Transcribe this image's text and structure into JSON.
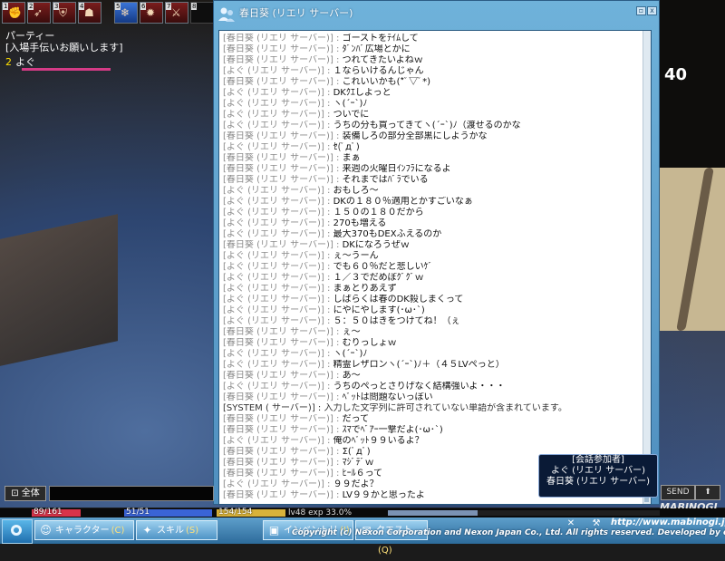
{
  "skillbar": {
    "slots": [
      {
        "key": "1",
        "style": "red",
        "icon": "fist"
      },
      {
        "key": "2",
        "style": "red",
        "icon": "kick"
      },
      {
        "key": "3",
        "style": "red",
        "icon": "shield"
      },
      {
        "key": "4",
        "style": "red",
        "icon": "crouch"
      },
      {
        "key": "5",
        "style": "blue",
        "icon": "ice"
      },
      {
        "key": "6",
        "style": "red",
        "icon": "fire"
      },
      {
        "key": "7",
        "style": "red",
        "icon": "sword"
      },
      {
        "key": "8",
        "style": "empty",
        "icon": ""
      }
    ]
  },
  "party": {
    "title": "パーティー",
    "subtitle": "[入場手伝いお願いします]",
    "member_num": "2",
    "member_name": "よぐ"
  },
  "scene": {
    "big_number": "40"
  },
  "chat": {
    "title": "春日葵 (リエリ サーバー)",
    "minimize": "▫",
    "close": "x",
    "messages": [
      {
        "who": "[春日葵 (リエリ サーバー)]",
        "text": "ゴーストをﾃｲﾑして"
      },
      {
        "who": "[春日葵 (リエリ サーバー)]",
        "text": "ﾀﾞﾝﾊﾞ広場とかに"
      },
      {
        "who": "[春日葵 (リエリ サーバー)]",
        "text": "つれてきたいよねｗ"
      },
      {
        "who": "[よぐ (リエリ サーバー)]",
        "text": "１ならいけるんじゃん"
      },
      {
        "who": "[春日葵 (リエリ サーバー)]",
        "text": "これいいかも(*ﾟ▽ﾟ*)"
      },
      {
        "who": "[よぐ (リエリ サーバー)]",
        "text": "DKｸｴしよっと"
      },
      {
        "who": "[よぐ (リエリ サーバー)]",
        "text": "ヽ(´ｰ`)ﾉ"
      },
      {
        "who": "[よぐ (リエリ サーバー)]",
        "text": "ついでに"
      },
      {
        "who": "[よぐ (リエリ サーバー)]",
        "text": "うちの分も買ってきてヽ(´ｰ`)ﾉ（渡せるのかな"
      },
      {
        "who": "[春日葵 (リエリ サーバー)]",
        "text": "装備しろの部分全部黒にしようかな"
      },
      {
        "who": "[よぐ (リエリ サーバー)]",
        "text": "ｾ(ﾟдﾟ)"
      },
      {
        "who": "[春日葵 (リエリ サーバー)]",
        "text": "まぁ"
      },
      {
        "who": "[春日葵 (リエリ サーバー)]",
        "text": "来週の火曜日ｲﾝﾌﾗになるよ"
      },
      {
        "who": "[春日葵 (リエリ サーバー)]",
        "text": "それまではﾊﾞﾗでいる"
      },
      {
        "who": "[よぐ (リエリ サーバー)]",
        "text": "おもしろ～"
      },
      {
        "who": "[よぐ (リエリ サーバー)]",
        "text": "DKの１８０％適用とかすごいなぁ"
      },
      {
        "who": "[よぐ (リエリ サーバー)]",
        "text": "１５０の１８０だから"
      },
      {
        "who": "[よぐ (リエリ サーバー)]",
        "text": "270も増える"
      },
      {
        "who": "[よぐ (リエリ サーバー)]",
        "text": "最大370もDEXふえるのか"
      },
      {
        "who": "[春日葵 (リエリ サーバー)]",
        "text": "DKになろうぜｗ"
      },
      {
        "who": "[よぐ (リエリ サーバー)]",
        "text": "ぇ～うーん"
      },
      {
        "who": "[よぐ (リエリ サーバー)]",
        "text": "でも６０％だと悲しいｹﾞ"
      },
      {
        "who": "[よぐ (リエリ サーバー)]",
        "text": "１／３でだめぽｸﾞｸﾞｗ"
      },
      {
        "who": "[よぐ (リエリ サーバー)]",
        "text": "まぁとりあえず"
      },
      {
        "who": "[よぐ (リエリ サーバー)]",
        "text": "しばらくは春のDK殺しまくって"
      },
      {
        "who": "[よぐ (リエリ サーバー)]",
        "text": "にやにやします(･ω･`)"
      },
      {
        "who": "[よぐ (リエリ サーバー)]",
        "text": "５：５０はきをつけてね！（ぇ"
      },
      {
        "who": "[春日葵 (リエリ サーバー)]",
        "text": "ぇ～"
      },
      {
        "who": "[春日葵 (リエリ サーバー)]",
        "text": "むりっしょｗ"
      },
      {
        "who": "[よぐ (リエリ サーバー)]",
        "text": "ヽ(´ｰ`)ﾉ"
      },
      {
        "who": "[よぐ (リエリ サーバー)]",
        "text": "精霊レザロンヽ(´ｰ`)ﾉ＋（４５LVぺっと）"
      },
      {
        "who": "[春日葵 (リエリ サーバー)]",
        "text": "あ～"
      },
      {
        "who": "[よぐ (リエリ サーバー)]",
        "text": "うちのぺっとさりげなく結構強いよ・・・"
      },
      {
        "who": "[春日葵 (リエリ サーバー)]",
        "text": "ﾍﾟｯﾄは問題ないっぽい"
      },
      {
        "who": "[SYSTEM ( サーバー)]",
        "text": "入力した文字列に許可されていない単語が含まれています。",
        "sys": true
      },
      {
        "who": "[春日葵 (リエリ サーバー)]",
        "text": "だって"
      },
      {
        "who": "[春日葵 (リエリ サーバー)]",
        "text": "ｽﾏでﾍﾞｱｰ一撃だよ(･ω･`)"
      },
      {
        "who": "[よぐ (リエリ サーバー)]",
        "text": "俺のﾍﾟｯﾄ９９いるよ？"
      },
      {
        "who": "[春日葵 (リエリ サーバー)]",
        "text": "Σ(ﾟдﾟ)"
      },
      {
        "who": "[春日葵 (リエリ サーバー)]",
        "text": "ﾏｼﾞﾃﾞｗ"
      },
      {
        "who": "[春日葵 (リエリ サーバー)]",
        "text": "ﾋｰﾙ６って"
      },
      {
        "who": "[よぐ (リエリ サーバー)]",
        "text": "９９だよ？"
      },
      {
        "who": "[春日葵 (リエリ サーバー)]",
        "text": "LV９９かと思ったよ"
      }
    ],
    "participants_title": "[会話参加者]",
    "participants": [
      "よぐ (リエリ サーバー)",
      "春日葵 (リエリ サーバー)"
    ]
  },
  "input": {
    "channel": "全体",
    "send": "SEND",
    "up": "⬆",
    "brand": "MABINOGI"
  },
  "status": {
    "hp": "89/161",
    "hp_ratio": 0.553,
    "mp": "51/51",
    "mp_ratio": 1.0,
    "sp": "154/154",
    "sp_ratio": 1.0,
    "level": "lv48",
    "exp": "exp 33.0%",
    "exp_ratio": 0.33,
    "colors": {
      "hp": "#d8344a",
      "mp": "#3a64d6",
      "sp": "#d8b23a"
    }
  },
  "menu": {
    "character": "キャラクター",
    "character_key": "(C)",
    "skill": "スキル",
    "skill_key": "(S)",
    "inventory": "インベントリ",
    "inventory_key": "(I)",
    "quest": "クエスト",
    "quest_key": "(Q)",
    "url": "http://www.mabinogi.jp",
    "copyright": "Copyright (c) Nexon Corporation and Nexon Japan Co., Ltd. All rights reserved. Developed by devCAT."
  }
}
